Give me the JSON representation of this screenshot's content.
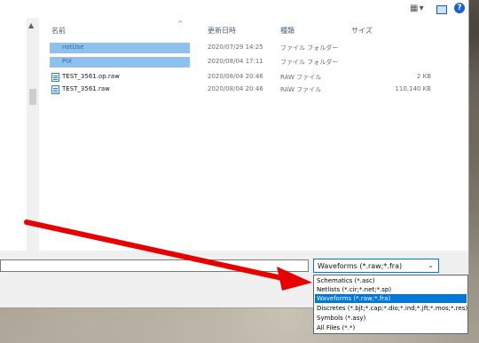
{
  "columns": {
    "name": "名前",
    "date": "更新日時",
    "type": "種類",
    "size": "サイズ"
  },
  "files": [
    {
      "name": "notUse",
      "date": "2020/07/29 14:25",
      "type": "ファイル フォルダー",
      "size": "",
      "selected": true
    },
    {
      "name": "PIX",
      "date": "2020/08/04 17:11",
      "type": "ファイル フォルダー",
      "size": "",
      "selected": true
    },
    {
      "name": "TEST_3561.op.raw",
      "date": "2020/08/04 20:46",
      "type": "RAW ファイル",
      "size": "2 KB",
      "selected": false
    },
    {
      "name": "TEST_3561.raw",
      "date": "2020/08/04 20:46",
      "type": "RAW ファイル",
      "size": "110,140 KB",
      "selected": false
    }
  ],
  "filetype": {
    "selected": "Waveforms (*.raw;*.fra)",
    "options": [
      "Schematics (*.asc)",
      "Netlists (*.cir;*.net;*.sp)",
      "Waveforms (*.raw;*.fra)",
      "Discretes (*.bjt;*.cap;*.dio;*.ind;*.jft;*.mos;*.res)",
      "Symbols (*.asy)",
      "All Files (*.*)"
    ],
    "active_index": 2
  },
  "annotation": {
    "arrow_color": "#e60000"
  },
  "icons": {
    "view": "view-options-icon",
    "pane": "preview-pane-icon",
    "help": "help-icon"
  }
}
